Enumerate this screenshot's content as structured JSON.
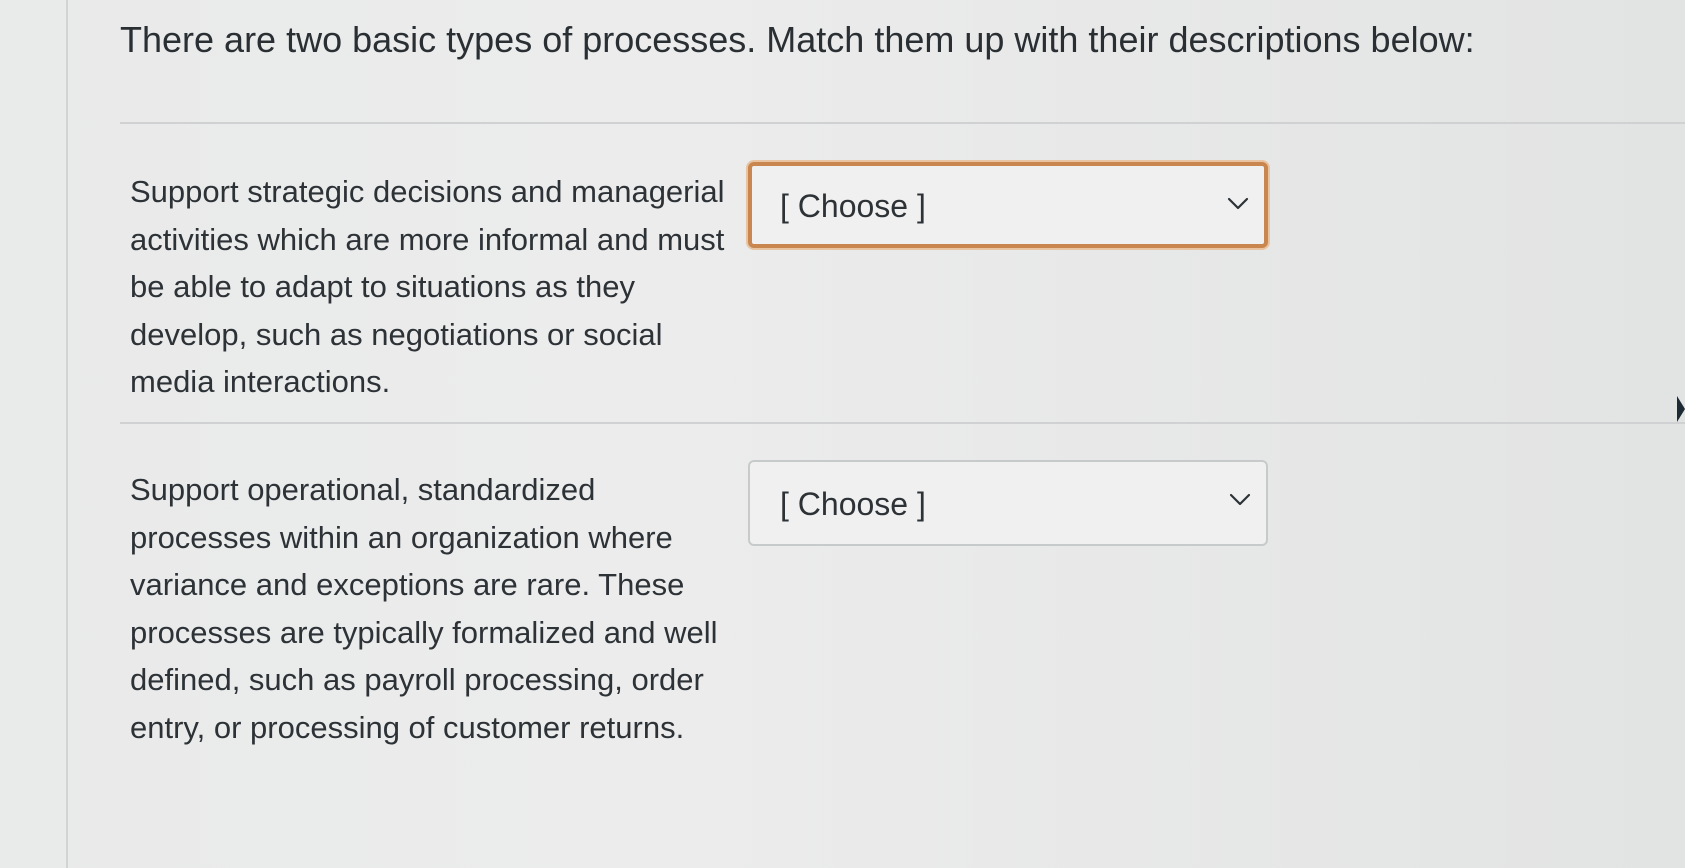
{
  "question": {
    "prompt": "There are two basic types of processes. Match them up with their descriptions below:"
  },
  "matches": [
    {
      "description": "Support strategic decisions and managerial activities which are more informal and must be able to adapt to situations as they develop, such as negotiations or social media interactions.",
      "select_value": "[ Choose ]",
      "focused": true
    },
    {
      "description": "Support operational, standardized processes within an organization where variance and exceptions are rare. These processes are typically formalized and well defined, such as payroll processing, order entry, or processing of customer returns.",
      "select_value": "[ Choose ]",
      "focused": false
    }
  ],
  "icons": {
    "dropdown": "chevron-down-icon",
    "edge": "caret-right-icon"
  },
  "colors": {
    "focus_ring": "#c9864f",
    "text": "#2d3237",
    "border": "#c7cacb"
  }
}
